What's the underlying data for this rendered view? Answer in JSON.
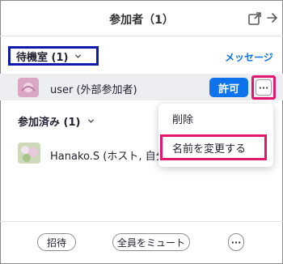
{
  "window": {
    "title": "参加者（1）"
  },
  "waiting_room": {
    "header": "待機室 (1)",
    "message_link": "メッセージ",
    "user": {
      "name": "user (外部参加者)"
    },
    "admit_label": "許可",
    "more_label": "···"
  },
  "context_menu": {
    "items": [
      {
        "label": "削除"
      },
      {
        "label": "名前を変更する"
      }
    ]
  },
  "joined": {
    "header": "参加済み (1)",
    "participant": {
      "name": "Hanako.S (ホスト, 自分)"
    }
  },
  "footer": {
    "invite_label": "招待",
    "mute_all_label": "全員をミュート",
    "more_label": "···"
  },
  "colors": {
    "accent_blue": "#0e72ed",
    "highlight_pink": "#e3176e",
    "highlight_navy": "#0e1aa8",
    "row_hover": "#eceef1"
  },
  "icons": [
    "popout-icon",
    "close-icon",
    "chevron-down-icon",
    "more-icon"
  ]
}
